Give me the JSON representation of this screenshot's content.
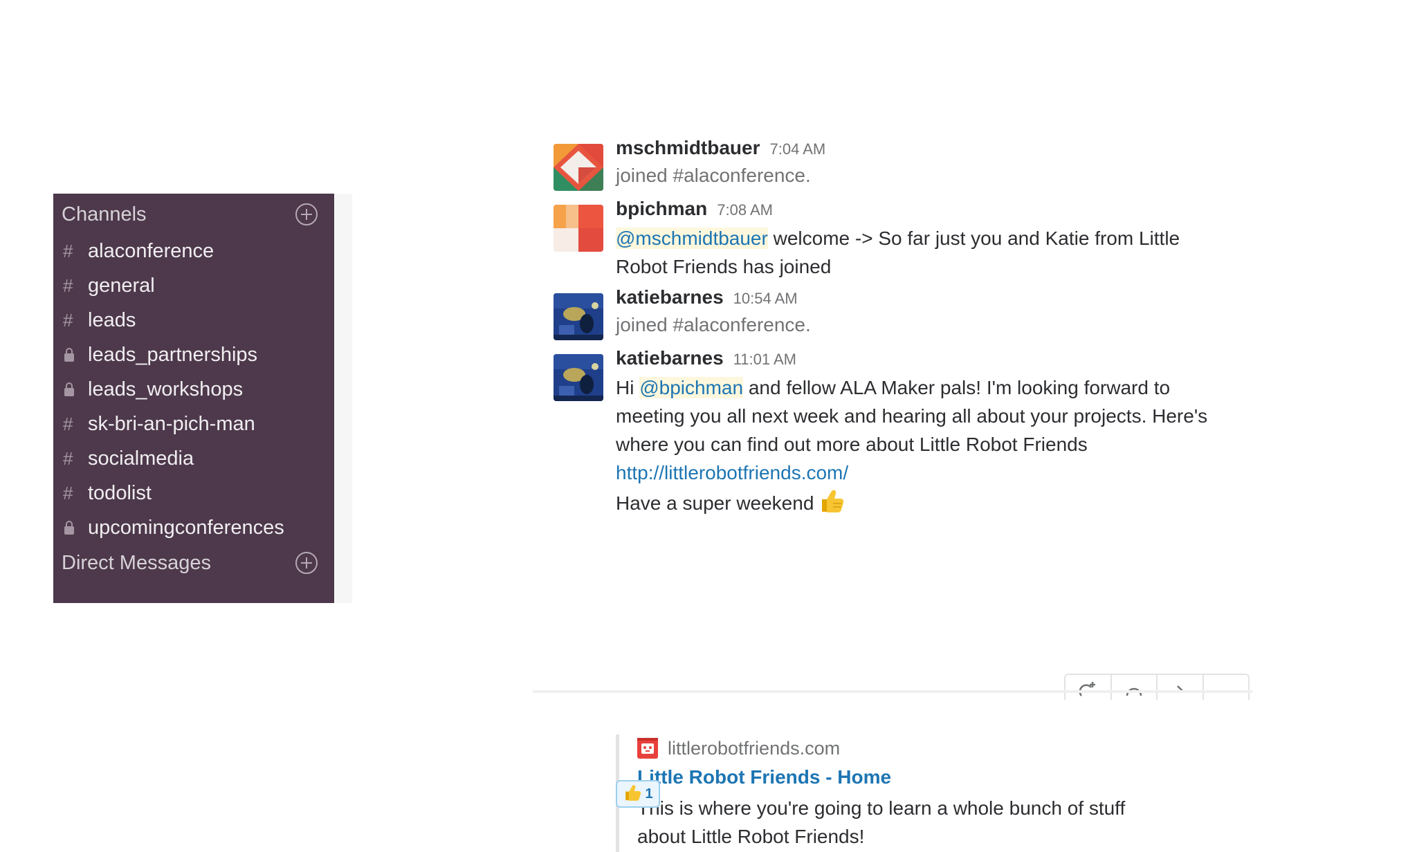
{
  "sidebar": {
    "channels_header": "Channels",
    "channels": [
      {
        "name": "alaconference",
        "type": "public"
      },
      {
        "name": "general",
        "type": "public"
      },
      {
        "name": "leads",
        "type": "public"
      },
      {
        "name": "leads_partnerships",
        "type": "private"
      },
      {
        "name": "leads_workshops",
        "type": "private"
      },
      {
        "name": "sk-bri-an-pich-man",
        "type": "public"
      },
      {
        "name": "socialmedia",
        "type": "public"
      },
      {
        "name": "todolist",
        "type": "public"
      },
      {
        "name": "upcomingconferences",
        "type": "private"
      }
    ],
    "hash_symbol": "#",
    "dm_header": "Direct Messages"
  },
  "messages": [
    {
      "username": "mschmidtbauer",
      "time": "7:04 AM",
      "text": "joined #alaconference."
    },
    {
      "username": "bpichman",
      "time": "7:08 AM",
      "mention": "@mschmidtbauer",
      "text": " welcome -> So far just you and Katie from Little Robot Friends has joined"
    },
    {
      "username": "katiebarnes",
      "time": "10:54 AM",
      "text": "joined #alaconference."
    },
    {
      "username": "katiebarnes",
      "time": "11:01 AM",
      "text_pre": "Hi ",
      "mention": "@bpichman",
      "text_post": " and fellow ALA Maker pals! I'm looking forward to meeting you all next week and hearing all about your projects. Here's where you can find out more about Little Robot Friends",
      "link": "http://littlerobotfriends.com/",
      "closing": "Have a super weekend",
      "attachment": {
        "service": "littlerobotfriends.com",
        "title": "Little Robot Friends - Home",
        "text": "This is where you're going to learn a whole bunch of stuff about Little Robot Friends!"
      },
      "reaction": {
        "emoji": "thumbs-up-icon",
        "count": "1"
      }
    }
  ],
  "colors": {
    "sidebar_bg": "#4d394b",
    "link": "#1d75b3",
    "mention_bg": "#fdf7dd"
  }
}
